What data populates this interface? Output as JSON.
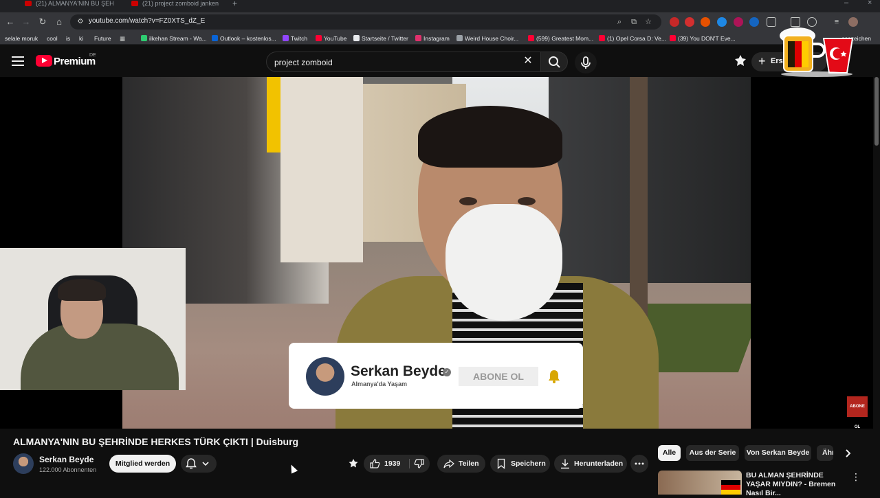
{
  "browser": {
    "tabs": [
      {
        "label": "(21) ALMANYA'NIN BU ŞEH"
      },
      {
        "label": "(21) project zomboid janken"
      }
    ],
    "url": "youtube.com/watch?v=FZ0XTS_dZ_E",
    "bookmarks": [
      {
        "label": "selale moruk",
        "color": "#f9ab00"
      },
      {
        "label": "cool",
        "color": "#f9ab00"
      },
      {
        "label": "is",
        "color": "#f9ab00"
      },
      {
        "label": "ki",
        "color": "#f9ab00"
      },
      {
        "label": "Future",
        "color": "#f9ab00"
      },
      {
        "label": "ilkehan Stream - Wa...",
        "color": "#2ecc71"
      },
      {
        "label": "Outlook – kostenlos...",
        "color": "#0a64d6"
      },
      {
        "label": "Twitch",
        "color": "#9146ff"
      },
      {
        "label": "YouTube",
        "color": "#ff0033"
      },
      {
        "label": "Startseite / Twitter",
        "color": "#e8eaed"
      },
      {
        "label": "Instagram",
        "color": "#e1306c"
      },
      {
        "label": "Weird House Choir...",
        "color": "#9aa0a6"
      },
      {
        "label": "(599) Greatest Mom...",
        "color": "#ff0033"
      },
      {
        "label": "(1) Opel Corsa D: Ve...",
        "color": "#ff0033"
      },
      {
        "label": "(39) You DON'T Eve...",
        "color": "#ff0033"
      },
      {
        "label": "esezeichen",
        "color": "#9aa0a6"
      }
    ]
  },
  "youtube": {
    "brand": "Premium",
    "region": "DE",
    "search_query": "project zomboid",
    "create_label": "Erst",
    "video": {
      "title": "ALMANYA'NIN BU ŞEHRİNDE HERKES TÜRK ÇIKTI | Duisburg",
      "overlay_card": {
        "channel": "Serkan Beyde",
        "subtitle": "Almanya'da Yaşam",
        "subscribe": "ABONE OL"
      },
      "corner_badge": "ABONE OL"
    },
    "channel": {
      "name": "Serkan Beyde",
      "subscribers": "122.000 Abonnenten",
      "join_label": "Mitglied werden"
    },
    "actions": {
      "likes": "1939",
      "share": "Teilen",
      "save": "Speichern",
      "download": "Herunterladen"
    },
    "chips": [
      "Alle",
      "Aus der Serie",
      "Von Serkan Beyde",
      "Ähnl"
    ],
    "recommendation": {
      "title": "BU ALMAN ŞEHRİNDE YAŞAR MIYDIN? - Bremen Nasıl Bir..."
    }
  },
  "colors": {
    "accent": "#ff0033",
    "background": "#0f0f0f",
    "chip_bg": "#272727"
  }
}
